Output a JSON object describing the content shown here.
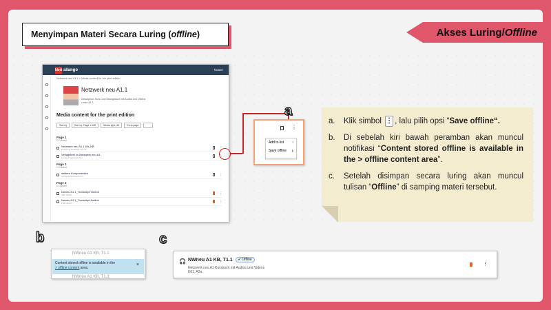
{
  "title": {
    "prefix": "Menyimpan Materi Secara Luring (",
    "italic": "offline",
    "suffix": ")"
  },
  "ribbon": {
    "prefix": "Akses Luring/",
    "italic": "Offline"
  },
  "screenshot": {
    "logo_badge": "klett",
    "brand": "allango",
    "header_right": "Nutzer",
    "breadcrumb": "Netzwerk neu A1.1 > Media content for the print edition",
    "book_title": "Netzwerk neu A1.1",
    "book_desc_1": "Description: Kurs- und Übungsbuch mit Audios und Videos",
    "book_desc_2": "Level: A1.1",
    "media_title": "Media content for the print edition",
    "filters": [
      "Sort by",
      "Sort by: Page 1-100",
      "Media type: All",
      "Go to page"
    ],
    "pages": [
      {
        "heading": "Page 1",
        "sub": "2 Content",
        "rows": [
          {
            "title": "Netzwerk neu A1.1 KB_KB",
            "sub": "Einleitung Netzwerk neu A1",
            "saved": false
          },
          {
            "title": "Verlagstext zu Netzwerk neu A1",
            "sub": "Langtext Netzwerk neu",
            "saved": false
          }
        ]
      },
      {
        "heading": "Page 2",
        "sub": "1 Content",
        "rows": [
          {
            "title": "weitere Komponenten",
            "sub": "Lehrwerk Netzwerk neu",
            "saved": false
          }
        ]
      },
      {
        "heading": "Page 3",
        "sub": "4 Content",
        "rows": [
          {
            "title": "Nwneu A1.1_Transkript Videos",
            "sub": "PDF, 00:00",
            "saved": true
          },
          {
            "title": "Nwneu A1.1_Transkript Audios",
            "sub": "PDF, 00:00",
            "saved": true
          }
        ]
      }
    ]
  },
  "labels": {
    "a": "a",
    "b": "b",
    "c": "c"
  },
  "popup_a": {
    "menu_items": [
      "Add to list",
      "Save offline"
    ],
    "icons": [
      "chevron-right-icon",
      "download-icon"
    ]
  },
  "instructions": {
    "a": {
      "label": "a.",
      "text_1": "Klik simbol",
      "text_2": ", lalu pilih opsi “",
      "bold": "Save offline",
      "text_3": "“."
    },
    "b": {
      "label": "b.",
      "text_1": "Di sebelah kiri bawah peramban akan muncul notifikasi “",
      "bold": "Content stored offline is available in the > offline content area",
      "text_2": "”."
    },
    "c": {
      "label": "c.",
      "text_1": "Setelah disimpan secara luring akan muncul tulisan “",
      "bold": "Offline",
      "text_2": "” di samping materi tersebut."
    }
  },
  "panel_b": {
    "bg_top": "NWneu A1 KB, T1.1",
    "bg_bottom": "NWneu A1 KB, T1.3",
    "toast_1": "Content stored offline is available in the",
    "toast_link": "> offline content",
    "toast_2": " area."
  },
  "panel_c": {
    "title": "NWneu A1 KB, T1.1",
    "badge": "Offline",
    "line_1": "Netzwerk neu A1 Kursbuch mit Audios und Videos",
    "line_2": "K01, A2a"
  },
  "colors": {
    "accent": "#e0566b",
    "note_bg": "#f4eccf",
    "highlight": "#c62828",
    "bookmark": "#e8621f"
  }
}
